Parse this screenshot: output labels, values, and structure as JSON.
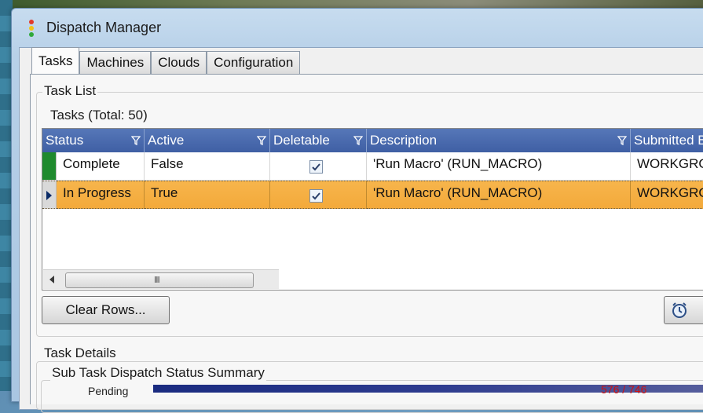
{
  "window": {
    "title": "Dispatch Manager"
  },
  "tabs": [
    {
      "label": "Tasks",
      "active": true
    },
    {
      "label": "Machines",
      "active": false
    },
    {
      "label": "Clouds",
      "active": false
    },
    {
      "label": "Configuration",
      "active": false
    }
  ],
  "task_list": {
    "group_title": "Task List",
    "total_label": "Tasks (Total: 50)",
    "columns": [
      "Status",
      "Active",
      "Deletable",
      "Description",
      "Submitted B"
    ],
    "rows": [
      {
        "status": "Complete",
        "active": "False",
        "deletable": true,
        "description": "'Run Macro' (RUN_MACRO)",
        "submitted_by": "WORKGRO",
        "status_color": "#1f8a2e",
        "selected": false
      },
      {
        "status": "In Progress",
        "active": "True",
        "deletable": true,
        "description": "'Run Macro' (RUN_MACRO)",
        "submitted_by": "WORKGRO",
        "row_color": "#f3a93a",
        "selected": true
      }
    ],
    "scroll_grip": "III",
    "clear_button": "Clear Rows..."
  },
  "task_details": {
    "group_title": "Task Details",
    "subgroup_title": "Sub Task Dispatch Status Summary",
    "pending_label": "Pending",
    "count_text": "576 / 746"
  },
  "colors": {
    "header_blue": "#3f5fa4",
    "selected_row": "#f3a93a",
    "complete_indicator": "#1f8a2e"
  }
}
